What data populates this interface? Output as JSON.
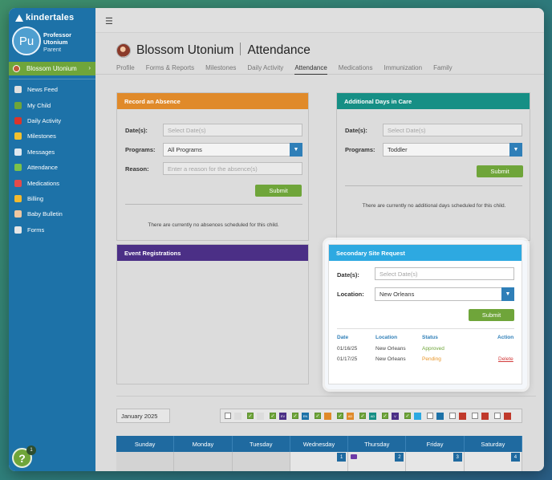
{
  "brand": {
    "name": "kindertales"
  },
  "user": {
    "initials": "Pu",
    "name": "Professor Utonium",
    "role": "Parent"
  },
  "child": {
    "name": "Blossom Utonium"
  },
  "nav": [
    {
      "label": "News Feed",
      "icon": "newspaper-icon",
      "color": "#e0e0e0"
    },
    {
      "label": "My Child",
      "icon": "child-icon",
      "color": "#6fa53a"
    },
    {
      "label": "Daily Activity",
      "icon": "apple-icon",
      "color": "#d9342b"
    },
    {
      "label": "Milestones",
      "icon": "star-icon",
      "color": "#f2c12e"
    },
    {
      "label": "Messages",
      "icon": "paper-plane-icon",
      "color": "#dfe8ef"
    },
    {
      "label": "Attendance",
      "icon": "calendar-icon",
      "color": "#7cc24a"
    },
    {
      "label": "Medications",
      "icon": "medical-icon",
      "color": "#e34b4b"
    },
    {
      "label": "Billing",
      "icon": "credit-card-icon",
      "color": "#f2b92e"
    },
    {
      "label": "Baby Bulletin",
      "icon": "baby-icon",
      "color": "#f0c7a0"
    },
    {
      "label": "Forms",
      "icon": "document-icon",
      "color": "#e6e6e6"
    }
  ],
  "help": {
    "label": "?",
    "badge": "1"
  },
  "header": {
    "child_name": "Blossom Utonium",
    "section": "Attendance",
    "tabs": [
      "Profile",
      "Forms & Reports",
      "Milestones",
      "Daily Activity",
      "Attendance",
      "Medications",
      "Immunization",
      "Family"
    ],
    "active_tab": "Attendance"
  },
  "absence": {
    "title": "Record an Absence",
    "color": "#e08a2a",
    "dates_label": "Date(s):",
    "dates_placeholder": "Select Date(s)",
    "programs_label": "Programs:",
    "programs_value": "All Programs",
    "reason_label": "Reason:",
    "reason_placeholder": "Enter a reason for the absence(s)",
    "submit": "Submit",
    "note": "There are currently no absences scheduled for this child."
  },
  "additional": {
    "title": "Additional Days in Care",
    "color": "#168f85",
    "dates_label": "Date(s):",
    "dates_placeholder": "Select Date(s)",
    "programs_label": "Programs:",
    "programs_value": "Toddler",
    "submit": "Submit",
    "note": "There are currently no additional days scheduled for this child."
  },
  "events": {
    "title": "Event Registrations",
    "color": "#4b2f86"
  },
  "secondary": {
    "title": "Secondary Site Request",
    "color": "#2da9e1",
    "dates_label": "Date(s):",
    "dates_placeholder": "Select Date(s)",
    "location_label": "Location:",
    "location_value": "New Orleans",
    "submit": "Submit",
    "columns": [
      "Date",
      "Location",
      "Status",
      "Action"
    ],
    "rows": [
      {
        "date": "01/16/25",
        "location": "New Orleans",
        "status": "Approved",
        "status_color": "#6fa53a",
        "action": ""
      },
      {
        "date": "01/17/25",
        "location": "New Orleans",
        "status": "Pending",
        "status_color": "#e8962a",
        "action": "Delete"
      }
    ]
  },
  "calendar": {
    "month": "January 2025",
    "legend": [
      {
        "checked": false,
        "tag": "",
        "color": "#dcdcdc"
      },
      {
        "checked": true,
        "tag": "",
        "color": "#dcdcdc"
      },
      {
        "checked": true,
        "tag": "EV",
        "color": "#4b2f86"
      },
      {
        "checked": true,
        "tag": "EN",
        "color": "#1d72a8"
      },
      {
        "checked": true,
        "tag": "",
        "color": "#e08a2a"
      },
      {
        "checked": true,
        "tag": "AD",
        "color": "#e08a2a"
      },
      {
        "checked": true,
        "tag": "AD",
        "color": "#168f85"
      },
      {
        "checked": true,
        "tag": "V",
        "color": "#4b2f86"
      },
      {
        "checked": true,
        "tag": "",
        "color": "#2da9e1"
      },
      {
        "checked": false,
        "tag": "",
        "color": "#1d72a8"
      },
      {
        "checked": false,
        "tag": "",
        "color": "#c0392b"
      },
      {
        "checked": false,
        "tag": "",
        "color": "#c0392b"
      },
      {
        "checked": false,
        "tag": "",
        "color": "#c0392b"
      }
    ],
    "days": [
      "Sunday",
      "Monday",
      "Tuesday",
      "Wednesday",
      "Thursday",
      "Friday",
      "Saturday"
    ],
    "first_row": [
      "",
      "",
      "",
      "1",
      "2",
      "3",
      "4"
    ]
  }
}
